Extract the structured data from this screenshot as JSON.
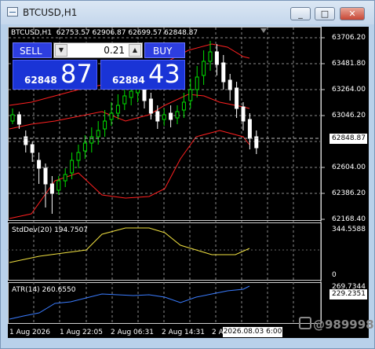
{
  "window": {
    "title": "BTCUSD,H1",
    "controls": [
      "_",
      "□",
      "✕"
    ]
  },
  "chart_header": {
    "symbol": "BTCUSD,H1",
    "ohlc": "62753.57 62906.87 62699.57 62848.87"
  },
  "trade_panel": {
    "sell_label": "SELL",
    "buy_label": "BUY",
    "lot_value": "0.21",
    "sell_price_small": "62848",
    "sell_price_big": "87",
    "buy_price_small": "62884",
    "buy_price_big": "43"
  },
  "price_scale": [
    "63706.20",
    "63481.80",
    "63264.00",
    "63046.20",
    "62604.00",
    "62386.20",
    "62168.40"
  ],
  "current_price": "62848.87",
  "stddev": {
    "label": "StdDev(20) 194.7507",
    "scale_top": "344.5588",
    "scale_bottom": "0"
  },
  "atr": {
    "label": "ATR(14) 260.6550",
    "scale_top": "269.7344",
    "value": "229.2351"
  },
  "time_axis": [
    "1 Aug 2026",
    "1 Aug 22:05",
    "2 Aug 06:31",
    "2 Aug 14:31",
    "2 A"
  ],
  "cursor_time": "2026.08.03 6:00",
  "watermark": "@989998",
  "colors": {
    "bull": "#00e000",
    "bear": "#ffffff",
    "band": "#ff2020",
    "stddev": "#f0e040",
    "atr": "#3a7cff",
    "background": "#000000"
  }
}
